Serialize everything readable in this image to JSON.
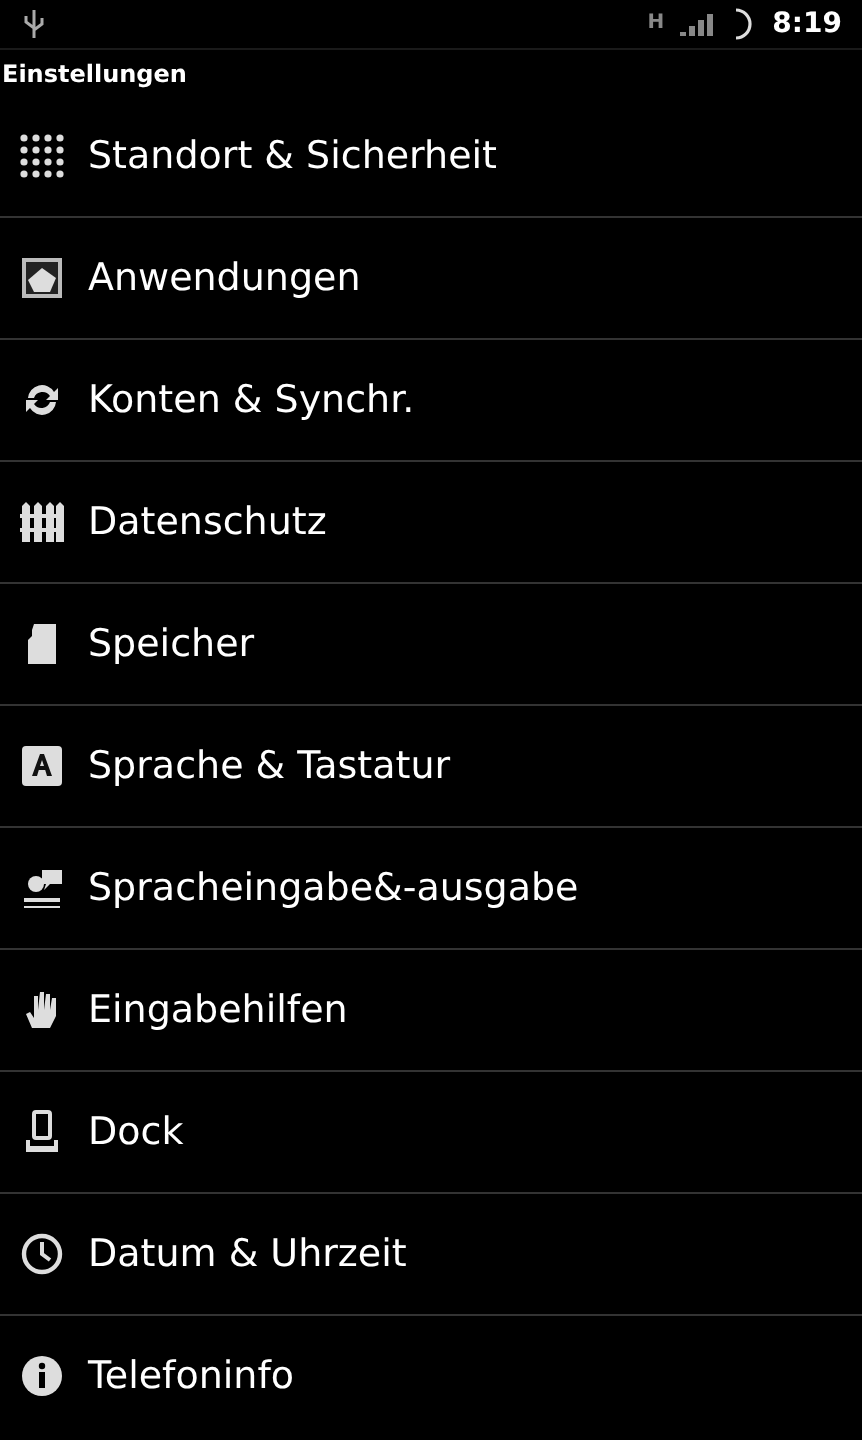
{
  "status_bar": {
    "network": "H",
    "time": "8:19"
  },
  "title": "Einstellungen",
  "items": [
    {
      "label": "Standort & Sicherheit"
    },
    {
      "label": "Anwendungen"
    },
    {
      "label": "Konten & Synchr."
    },
    {
      "label": "Datenschutz"
    },
    {
      "label": "Speicher"
    },
    {
      "label": "Sprache & Tastatur"
    },
    {
      "label": "Spracheingabe&-ausgabe"
    },
    {
      "label": "Eingabehilfen"
    },
    {
      "label": "Dock"
    },
    {
      "label": "Datum & Uhrzeit"
    },
    {
      "label": "Telefoninfo"
    }
  ]
}
